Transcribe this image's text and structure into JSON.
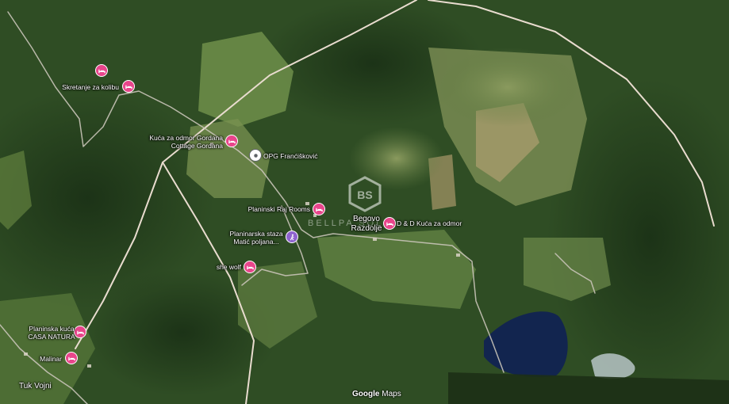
{
  "map": {
    "colors": {
      "forest": "#2f4d24",
      "meadow": "#6d8a4a",
      "road": "#e8d9cc",
      "lake": "#12254f",
      "pin": "#e8458b"
    },
    "places": [
      {
        "id": "pin-skretanje",
        "icon": "lodging-icon",
        "label": "Skretanje za kolibu"
      },
      {
        "id": "pin-top-left",
        "icon": "lodging-icon",
        "label": ""
      },
      {
        "id": "pin-kuca-gordana",
        "icon": "lodging-icon",
        "label": "Kuća za odmor Gordana\nCottage Gordana"
      },
      {
        "id": "pin-opg",
        "icon": "place-icon",
        "label": "OPG Franćišković"
      },
      {
        "id": "pin-planinski-raj",
        "icon": "lodging-icon",
        "label": "Planinski Raj Rooms"
      },
      {
        "id": "pin-dd-kuca",
        "icon": "lodging-icon",
        "label": "D & D Kuća za odmor"
      },
      {
        "id": "pin-matic",
        "icon": "hiking-icon",
        "label": "Planinarska staza\nMatić poljana..."
      },
      {
        "id": "pin-she-wolf",
        "icon": "lodging-icon",
        "label": "she wolf"
      },
      {
        "id": "pin-casa-natura",
        "icon": "lodging-icon",
        "label": "Planinska kuća\nCASA NATURA"
      },
      {
        "id": "pin-malinar",
        "icon": "lodging-icon",
        "label": "Malinar"
      }
    ],
    "localities": {
      "begovo_razdolje": "Begovo\nRazdolje",
      "tuk_vojni": "Tuk Vojni"
    },
    "watermark": "BELLPA SOLID",
    "attribution": {
      "brand": "Google",
      "product": "Maps"
    }
  }
}
